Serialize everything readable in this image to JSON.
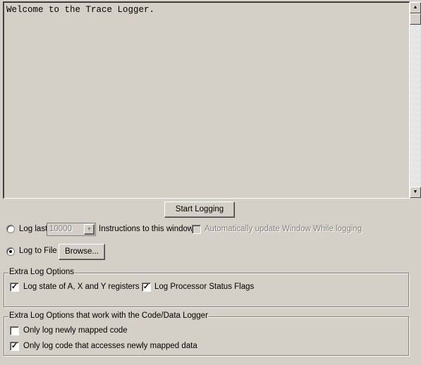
{
  "log_text": "Welcome to the Trace Logger.",
  "start_button": "Start Logging",
  "log_last": {
    "label": "Log last",
    "value": "10000",
    "suffix": "Instructions to this window",
    "selected": false
  },
  "auto_update": {
    "label": "Automatically update Window While logging",
    "checked": false,
    "disabled": true
  },
  "log_to_file": {
    "label": "Log to File",
    "selected": true,
    "browse": "Browse..."
  },
  "group1": {
    "title": "Extra Log Options",
    "items": [
      {
        "label": "Log state of A, X and Y registers",
        "checked": true
      },
      {
        "label": "Log Processor Status Flags",
        "checked": true
      }
    ]
  },
  "group2": {
    "title": "Extra Log Options that work with the Code/Data Logger",
    "items": [
      {
        "label": "Only log newly mapped code",
        "checked": false
      },
      {
        "label": "Only log code that accesses newly mapped data",
        "checked": true
      }
    ]
  }
}
